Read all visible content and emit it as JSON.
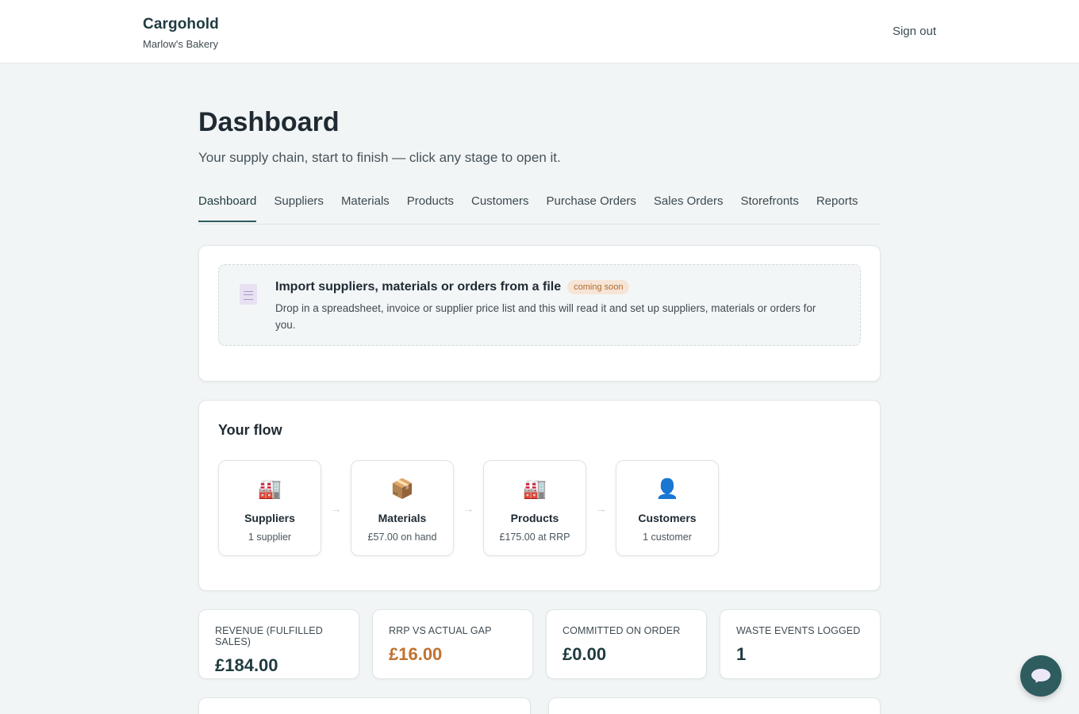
{
  "header": {
    "brand": "Cargohold",
    "business": "Marlow's Bakery",
    "signout_label": "Sign out"
  },
  "page": {
    "title": "Dashboard",
    "subtitle": "Your supply chain, start to finish — click any stage to open it."
  },
  "tabs": [
    {
      "label": "Dashboard",
      "active": true
    },
    {
      "label": "Suppliers"
    },
    {
      "label": "Materials"
    },
    {
      "label": "Products"
    },
    {
      "label": "Customers"
    },
    {
      "label": "Purchase Orders"
    },
    {
      "label": "Sales Orders"
    },
    {
      "label": "Storefronts"
    },
    {
      "label": "Reports"
    }
  ],
  "import": {
    "icon": "document-icon",
    "title": "Import suppliers, materials or orders from a file",
    "badge": "coming soon",
    "description": "Drop in a spreadsheet, invoice or supplier price list and this will read it and set up suppliers, materials or orders for you."
  },
  "flow": {
    "title": "Your flow",
    "arrow": "→",
    "stages": [
      {
        "icon": "🏭",
        "icon_name": "factory-icon",
        "name": "Suppliers",
        "meta": "1 supplier"
      },
      {
        "icon": "📦",
        "icon_name": "package-icon",
        "name": "Materials",
        "meta": "£57.00 on hand"
      },
      {
        "icon": "🏭",
        "icon_name": "factory-icon",
        "name": "Products",
        "meta": "£175.00 at RRP"
      },
      {
        "icon": "👤",
        "icon_name": "person-icon",
        "name": "Customers",
        "meta": "1 customer"
      }
    ]
  },
  "stats": [
    {
      "label": "REVENUE (FULFILLED SALES)",
      "value": "£184.00",
      "color": "#1f3b40"
    },
    {
      "label": "RRP VS ACTUAL GAP",
      "value": "£16.00",
      "color": "#c0722f"
    },
    {
      "label": "COMMITTED ON ORDER",
      "value": "£0.00",
      "color": "#1f3b40"
    },
    {
      "label": "WASTE EVENTS LOGGED",
      "value": "1",
      "color": "#1f3b40"
    }
  ],
  "colors": {
    "accent": "#2c5a60",
    "background": "#f2f5f5",
    "badge_text": "#b36a2e",
    "badge_bg": "#f6e5d6"
  }
}
